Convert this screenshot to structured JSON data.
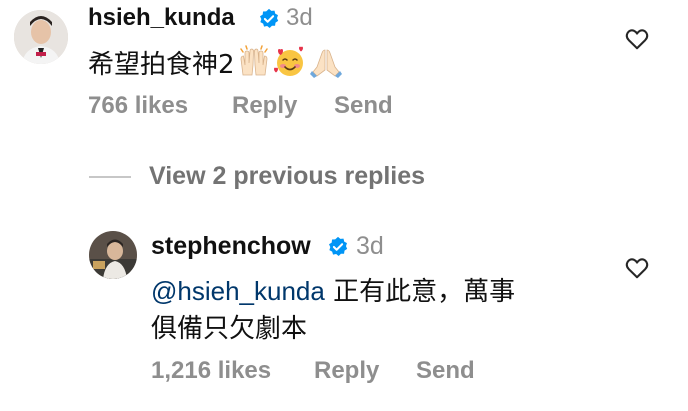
{
  "comment": {
    "username": "hsieh_kunda",
    "time": "3d",
    "text": "希望拍食神2",
    "emojis": [
      "raising-hands-emoji",
      "smiling-face-with-hearts-emoji",
      "folded-hands-emoji"
    ],
    "likes": "766 likes",
    "reply_label": "Reply",
    "send_label": "Send"
  },
  "view_replies": {
    "label": "View 2 previous replies"
  },
  "reply": {
    "username": "stephenchow",
    "time": "3d",
    "mention": "@hsieh_kunda",
    "text_line1": " 正有此意，萬事",
    "text_line2": "俱備只欠劇本",
    "likes": "1,216 likes",
    "reply_label": "Reply",
    "send_label": "Send"
  },
  "colors": {
    "username": "#111111",
    "meta": "#8e8e8e",
    "mention": "#00376b",
    "verified": "#0095f6",
    "divider": "#c7c7c7"
  }
}
